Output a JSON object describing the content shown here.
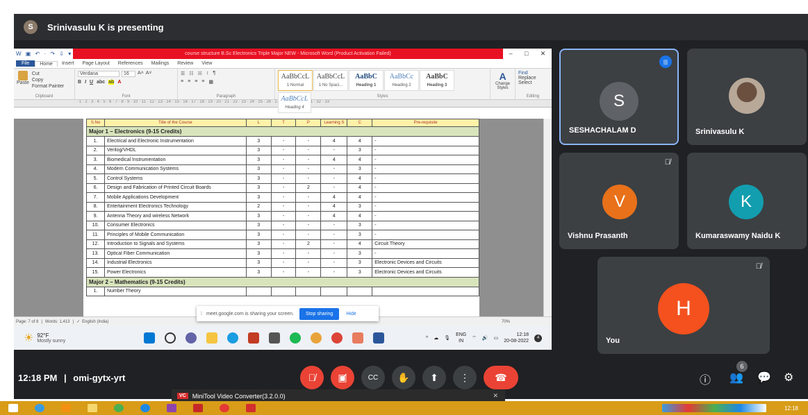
{
  "presenter": {
    "initial": "S",
    "text": "Srinivasulu K is presenting"
  },
  "word": {
    "qat": "W ▣ ↶ · ↷ ⇩ ▾",
    "title": "course structure B.Sc Electronics Triple Major NEW - Microsoft Word (Product Activation Failed)",
    "tabs": [
      "File",
      "Home",
      "Insert",
      "Page Layout",
      "References",
      "Mailings",
      "Review",
      "View"
    ],
    "ribbon": {
      "clipboard": [
        "Cut",
        "Copy",
        "Paste",
        "Format Painter"
      ],
      "clipboard_label": "Clipboard",
      "font_name": "Verdana",
      "font_size": "16",
      "font_label": "Font",
      "paragraph_label": "Paragraph",
      "styles": [
        {
          "preview": "AaBbCcL",
          "name": "1 Normal"
        },
        {
          "preview": "AaBbCcL",
          "name": "1 No Spaci..."
        },
        {
          "preview": "AaBbC",
          "name": "Heading 1"
        },
        {
          "preview": "AaBbCc",
          "name": "Heading 2"
        },
        {
          "preview": "AaBbC",
          "name": "Heading 3"
        },
        {
          "preview": "AaBbCcL",
          "name": "Heading 4"
        }
      ],
      "styles_label": "Styles",
      "change_styles": "Change Styles",
      "editing": [
        "Find",
        "Replace",
        "Select"
      ],
      "editing_label": "Editing"
    },
    "header_cells": [
      "S.No",
      "Title of the Course",
      "L",
      "T",
      "P",
      "Learning S",
      "C",
      "Pre-requisite"
    ],
    "major1_title": "Major 1 – Electronics (9-15 Credits)",
    "rows": [
      {
        "no": "1.",
        "title": "Electrical and Electronic Instrumentation",
        "l": "3",
        "t": "-",
        "p": "-",
        "s": "4",
        "c": "4",
        "pre": "-"
      },
      {
        "no": "2.",
        "title": "Verilog/VHDL",
        "l": "3",
        "t": "-",
        "p": "-",
        "s": "-",
        "c": "3",
        "pre": "-"
      },
      {
        "no": "3.",
        "title": "Biomedical Instrumentation",
        "l": "3",
        "t": "-",
        "p": "-",
        "s": "4",
        "c": "4",
        "pre": "-"
      },
      {
        "no": "4.",
        "title": "Modern Communication Systems",
        "l": "3",
        "t": "-",
        "p": "-",
        "s": "-",
        "c": "3",
        "pre": "-"
      },
      {
        "no": "5.",
        "title": "Control Systems",
        "l": "3",
        "t": "-",
        "p": "-",
        "s": "-",
        "c": "4",
        "pre": "-"
      },
      {
        "no": "6.",
        "title": "Design and Fabrication of Printed Circuit Boards",
        "l": "3",
        "t": "-",
        "p": "2",
        "s": "-",
        "c": "4",
        "pre": "-"
      },
      {
        "no": "7.",
        "title": "Mobile Applications Development",
        "l": "3",
        "t": "-",
        "p": "-",
        "s": "4",
        "c": "4",
        "pre": "-"
      },
      {
        "no": "8.",
        "title": "Entertainment Electronics Technology",
        "l": "2",
        "t": "-",
        "p": "-",
        "s": "4",
        "c": "3",
        "pre": "-"
      },
      {
        "no": "9.",
        "title": "Antenna Theory and wireless Network",
        "l": "3",
        "t": "-",
        "p": "-",
        "s": "4",
        "c": "4",
        "pre": "-"
      },
      {
        "no": "10.",
        "title": "Consumer Electronics",
        "l": "3",
        "t": "-",
        "p": "-",
        "s": "-",
        "c": "3",
        "pre": "-"
      },
      {
        "no": "11.",
        "title": "Principles of Mobile Communication",
        "l": "3",
        "t": "-",
        "p": "-",
        "s": "-",
        "c": "3",
        "pre": "-"
      },
      {
        "no": "12.",
        "title": "Introduction to Signals and Systems",
        "l": "3",
        "t": "-",
        "p": "2",
        "s": "-",
        "c": "4",
        "pre": "Circuit Theory"
      },
      {
        "no": "13.",
        "title": "Optical Fiber Communication",
        "l": "3",
        "t": "-",
        "p": "-",
        "s": "-",
        "c": "3",
        "pre": "-"
      },
      {
        "no": "14.",
        "title": "Industrial Electronics",
        "l": "3",
        "t": "-",
        "p": "-",
        "s": "-",
        "c": "3",
        "pre": "Electronic Devices and Circuits"
      },
      {
        "no": "15.",
        "title": "Power Electronics",
        "l": "3",
        "t": "-",
        "p": "-",
        "s": "-",
        "c": "3",
        "pre": "Electronic Devices and Circuits"
      }
    ],
    "major2_title": "Major 2 – Mathematics (9-15 Credits)",
    "row2_first": {
      "no": "1.",
      "title": "Number Theory"
    },
    "status": {
      "page": "Page: 7 of 8",
      "words": "Words: 1,413",
      "lang": "English (India)",
      "zoom": "70%"
    }
  },
  "share_banner": {
    "text": "meet.google.com is sharing your screen.",
    "stop": "Stop sharing",
    "hide": "Hide"
  },
  "inner_taskbar": {
    "temp": "92°F",
    "weather": "Mostly sunny",
    "lang1": "ENG",
    "lang2": "IN",
    "time": "12:18",
    "date": "20-08-2022"
  },
  "participants": [
    {
      "name": "SESHACHALAM D",
      "initial": "S",
      "color": "#5f6368",
      "state": "speaking"
    },
    {
      "name": "Srinivasulu K",
      "initial": "",
      "color": "#8a7a6a",
      "state": "photo"
    },
    {
      "name": "Vishnu Prasanth",
      "initial": "V",
      "color": "#e8711a",
      "state": "muted"
    },
    {
      "name": "Kumaraswamy Naidu K",
      "initial": "K",
      "color": "#129eaf",
      "state": "none"
    },
    {
      "name": "You",
      "initial": "H",
      "color": "#f4511e",
      "state": "muted"
    }
  ],
  "meeting": {
    "time": "12:18 PM",
    "separator": "|",
    "code": "omi-gytx-yrt"
  },
  "people_count": "6",
  "popup": {
    "badge": "VC",
    "title": "MiniTool Video Converter(3.2.0.0)",
    "close": "✕"
  },
  "host_clock": "12:18"
}
